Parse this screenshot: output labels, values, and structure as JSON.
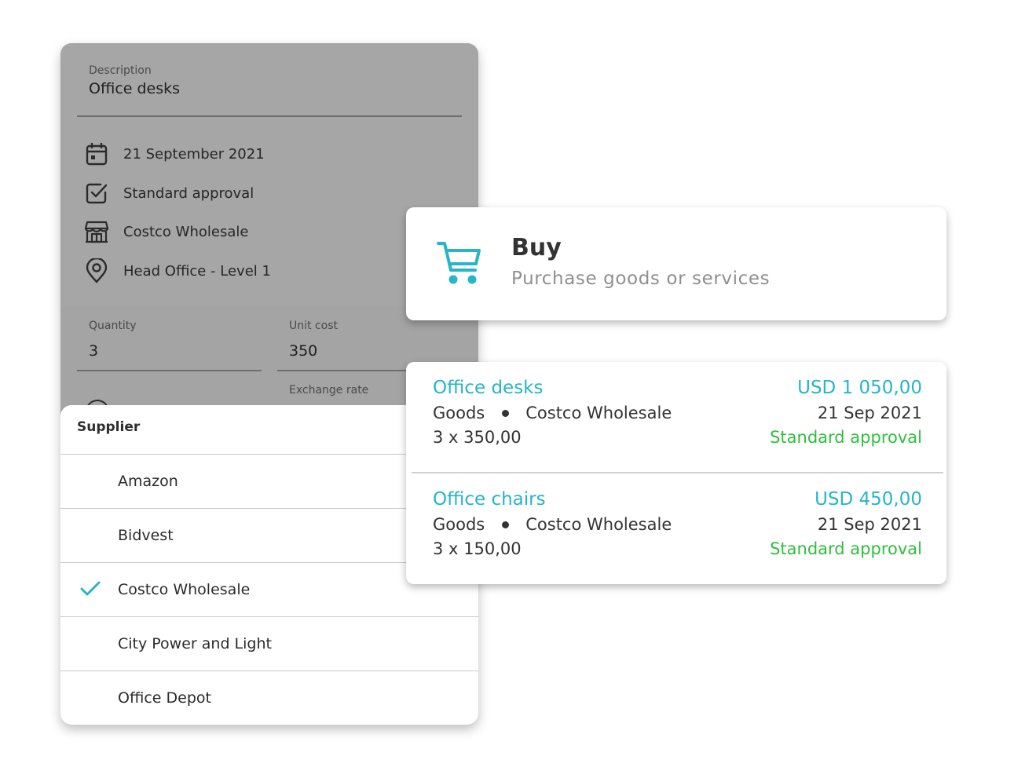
{
  "form": {
    "description_label": "Description",
    "description_value": "Office desks",
    "details": [
      {
        "icon": "calendar-icon",
        "text": "21 September 2021"
      },
      {
        "icon": "checkbox-icon",
        "text": "Standard approval"
      },
      {
        "icon": "store-icon",
        "text": "Costco Wholesale"
      },
      {
        "icon": "location-pin-icon",
        "text": "Head Office - Level 1"
      }
    ],
    "quantity_label": "Quantity",
    "quantity_value": "3",
    "unit_cost_label": "Unit cost",
    "unit_cost_value": "350",
    "exchange_rate_label": "Exchange rate"
  },
  "supplier_picker": {
    "title": "Supplier",
    "selected": "Costco Wholesale",
    "options": [
      "Amazon",
      "Bidvest",
      "Costco Wholesale",
      "City Power and Light",
      "Office Depot"
    ]
  },
  "buy_card": {
    "icon": "shopping-cart-icon",
    "title": "Buy",
    "subtitle": "Purchase goods or services"
  },
  "transactions": [
    {
      "name": "Office desks",
      "amount": "USD 1 050,00",
      "category": "Goods",
      "supplier": "Costco Wholesale",
      "date": "21 Sep 2021",
      "qty_line": "3 x 350,00",
      "status": "Standard approval"
    },
    {
      "name": "Office chairs",
      "amount": "USD 450,00",
      "category": "Goods",
      "supplier": "Costco Wholesale",
      "date": "21 Sep 2021",
      "qty_line": "3 x 150,00",
      "status": "Standard approval"
    }
  ],
  "colors": {
    "accent": "#27b5c8",
    "status_green": "#2fbf3a",
    "overlay_gray": "#a6a6a6"
  }
}
